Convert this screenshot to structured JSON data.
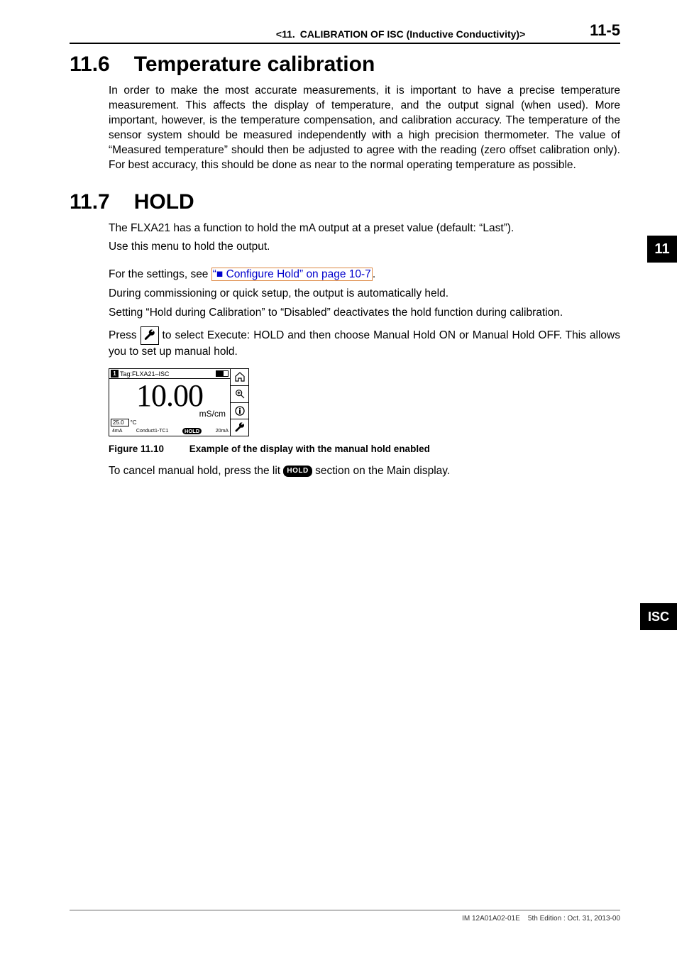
{
  "header": {
    "title": "<11. CALIBRATION OF ISC (Inductive Conductivity)>",
    "page": "11-5"
  },
  "tabs": {
    "chapter": "11",
    "isc": "ISC"
  },
  "section_11_6": {
    "num": "11.6",
    "title": "Temperature calibration",
    "p1": "In order to make the most accurate measurements, it is important to have a precise temperature measurement. This affects the display of temperature, and the output signal (when used). More important, however, is the temperature compensation, and calibration accuracy. The temperature of the sensor system should be measured independently with a high precision thermometer. The value of “Measured temperature” should then be adjusted to agree with the reading (zero offset calibration only). For best accuracy, this should be done as near to the normal operating temperature as possible."
  },
  "section_11_7": {
    "num": "11.7",
    "title": "HOLD",
    "p1": "The FLXA21 has a function to hold the mA output at a preset value (default: “Last”).",
    "p2": "Use this menu to hold the output.",
    "p3a": "For the settings, see ",
    "link": "“■ Configure Hold” on page 10-7",
    "p3b": ".",
    "p4": "During commissioning or quick setup, the output is automatically held.",
    "p5": "Setting “Hold during Calibration” to “Disabled” deactivates the hold function during calibration.",
    "p6a": "Press ",
    "p6b": " to select Execute: HOLD and then choose Manual Hold ON or Manual Hold OFF. This allows you to set up manual hold.",
    "fig": {
      "label": "Figure 11.10",
      "caption": "Example of the display with the manual hold enabled"
    },
    "p7a": "To cancel manual hold, press the lit  ",
    "hold_chip": "HOLD",
    "p7b": "  section on the Main display."
  },
  "device": {
    "tag_num": "1",
    "tag_label": "Tag:FLXA21–ISC",
    "value": "10.00",
    "unit": "mS/cm",
    "temp": "25.0",
    "temp_unit": "°C",
    "low": "4mA",
    "mid": "Conduct1-TC1",
    "hold": "HOLD",
    "high": "20mA"
  },
  "footer": {
    "doc": "IM 12A01A02-01E",
    "edition": "5th Edition : Oct. 31, 2013-00"
  }
}
